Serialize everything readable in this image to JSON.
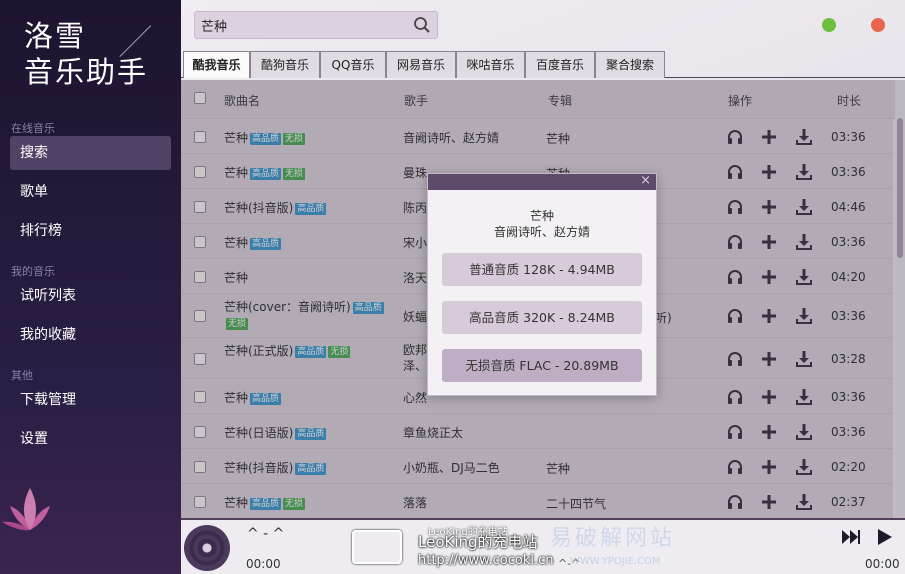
{
  "app": {
    "logo_line1": "洛雪",
    "logo_line2": "音乐助手"
  },
  "sidebar": {
    "sections": [
      {
        "title": "在线音乐",
        "items": [
          "搜索",
          "歌单",
          "排行榜"
        ]
      },
      {
        "title": "我的音乐",
        "items": [
          "试听列表",
          "我的收藏"
        ]
      },
      {
        "title": "其他",
        "items": [
          "下载管理",
          "设置"
        ]
      }
    ],
    "active_item": "搜索"
  },
  "search": {
    "value": "芒种",
    "placeholder": ""
  },
  "tabs": [
    "酷我音乐",
    "酷狗音乐",
    "QQ音乐",
    "网易音乐",
    "咪咕音乐",
    "百度音乐",
    "聚合搜索"
  ],
  "active_tab": "酷我音乐",
  "table": {
    "headers": {
      "name": "歌曲名",
      "artist": "歌手",
      "album": "专辑",
      "actions": "操作",
      "duration": "时长"
    },
    "rows": [
      {
        "name": "芒种",
        "hq": "高品质",
        "free": "无损",
        "artist": "音阙诗听、赵方婧",
        "album": "芒种",
        "duration": "03:36"
      },
      {
        "name": "芒种",
        "hq": "高品质",
        "free": "无损",
        "artist": "曼珠",
        "album": "芒种",
        "duration": "03:36"
      },
      {
        "name": "芒种(抖音版)",
        "hq": "高品质",
        "free": "",
        "artist": "陈丙",
        "album": "",
        "duration": "04:46"
      },
      {
        "name": "芒种",
        "hq": "高品质",
        "free": "",
        "artist": "宋小",
        "album": "",
        "duration": "03:36"
      },
      {
        "name": "芒种",
        "hq": "",
        "free": "",
        "artist": "洛天",
        "album": "",
        "duration": "04:20"
      },
      {
        "name": "芒种(cover：音阙诗听)",
        "hq": "高品质",
        "free": "无损",
        "artist": "妖蝠",
        "album": "听)",
        "duration": "03:36"
      },
      {
        "name": "芒种(正式版)",
        "hq": "高品质",
        "free": "无损",
        "artist": "欧邦",
        "artist2": "泽、",
        "album": "",
        "duration": "03:28"
      },
      {
        "name": "芒种",
        "hq": "高品质",
        "free": "",
        "artist": "心然",
        "album": "",
        "duration": "03:36"
      },
      {
        "name": "芒种(日语版)",
        "hq": "高品质",
        "free": "",
        "artist": "章鱼烧正太",
        "album": "",
        "duration": "03:36"
      },
      {
        "name": "芒种(抖音版)",
        "hq": "高品质",
        "free": "",
        "artist": "小奶瓶、DJ马二色",
        "album": "芒种",
        "duration": "02:20"
      },
      {
        "name": "芒种",
        "hq": "高品质",
        "free": "无损",
        "artist": "落落",
        "album": "二十四节气",
        "duration": "02:37"
      }
    ]
  },
  "modal": {
    "title": "芒种",
    "subtitle": "音阙诗听、赵方婧",
    "close": "×",
    "options": [
      "普通音质 128K - 4.94MB",
      "高品音质 320K - 8.24MB",
      "无损音质 FLAC - 20.89MB"
    ]
  },
  "player": {
    "title": "^ - ^",
    "time_current": "00:00",
    "time_total": "00:00",
    "mid_text": "^-^"
  },
  "watermarks": {
    "site": "易破解网站",
    "site_url": "WWW.YPOJIE.COM",
    "overlay_top": "LeoKing的充电站",
    "overlay_main": "LeoKing的充电站",
    "overlay_url": "http://www.cocokl.cn"
  },
  "colors": {
    "sidebar_bg": "#241a3a",
    "accent_dark": "#5e4a6b",
    "tag_hq": "#2f92c7",
    "tag_free": "#3fa64a",
    "win_min": "#6dbf3f",
    "win_close": "#e8664e"
  },
  "icons": {
    "listen": "headphones-icon",
    "add": "plus-icon",
    "download": "download-icon"
  }
}
